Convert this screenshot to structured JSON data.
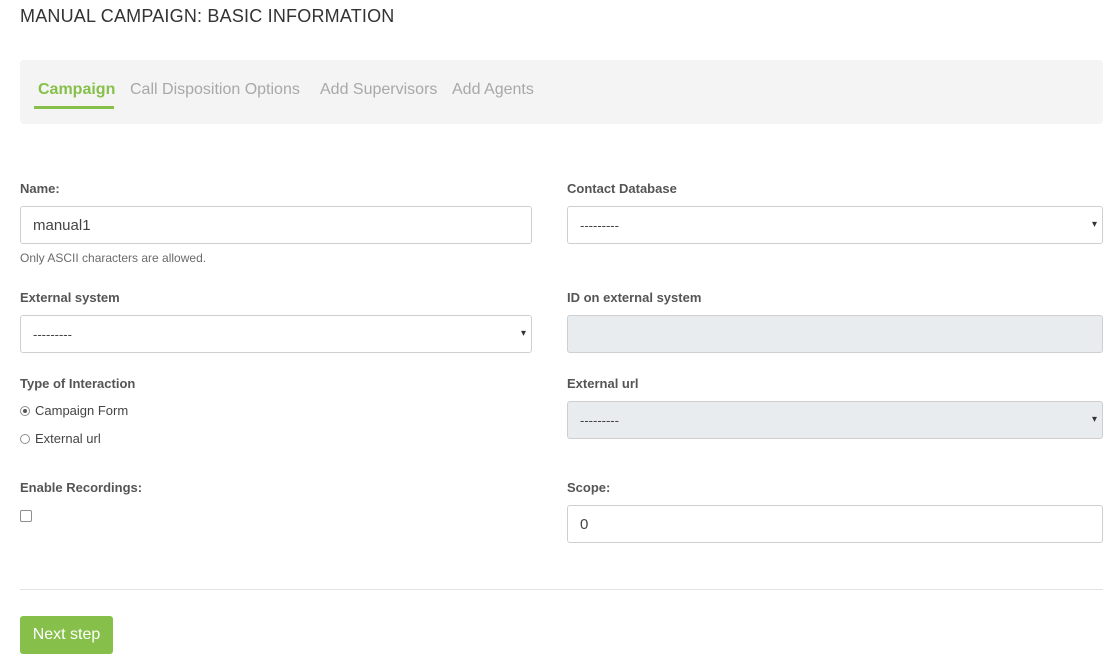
{
  "page": {
    "title": "MANUAL CAMPAIGN: BASIC INFORMATION"
  },
  "tabs": [
    {
      "label": "Campaign",
      "active": true
    },
    {
      "label": "Call Disposition Options",
      "active": false
    },
    {
      "label": "Add Supervisors",
      "active": false
    },
    {
      "label": "Add Agents",
      "active": false
    }
  ],
  "colors": {
    "accent": "#86c04a",
    "tabs_bg": "#f4f4f4",
    "disabled_bg": "#e9ecef"
  },
  "form": {
    "name": {
      "label": "Name:",
      "value": "manual1",
      "help": "Only ASCII characters are allowed."
    },
    "contact_database": {
      "label": "Contact Database",
      "value": "---------"
    },
    "external_system": {
      "label": "External system",
      "value": "---------"
    },
    "id_external": {
      "label": "ID on external system",
      "value": ""
    },
    "interaction": {
      "label": "Type of Interaction",
      "options": [
        {
          "label": "Campaign Form",
          "checked": true
        },
        {
          "label": "External url",
          "checked": false
        }
      ]
    },
    "external_url": {
      "label": "External url",
      "value": "---------"
    },
    "recordings": {
      "label": "Enable Recordings:",
      "checked": false
    },
    "scope": {
      "label": "Scope:",
      "value": "0"
    }
  },
  "actions": {
    "next_label": "Next step"
  },
  "icons": {
    "select_caret": "caret-down-icon",
    "caret_glyph": "▾"
  }
}
